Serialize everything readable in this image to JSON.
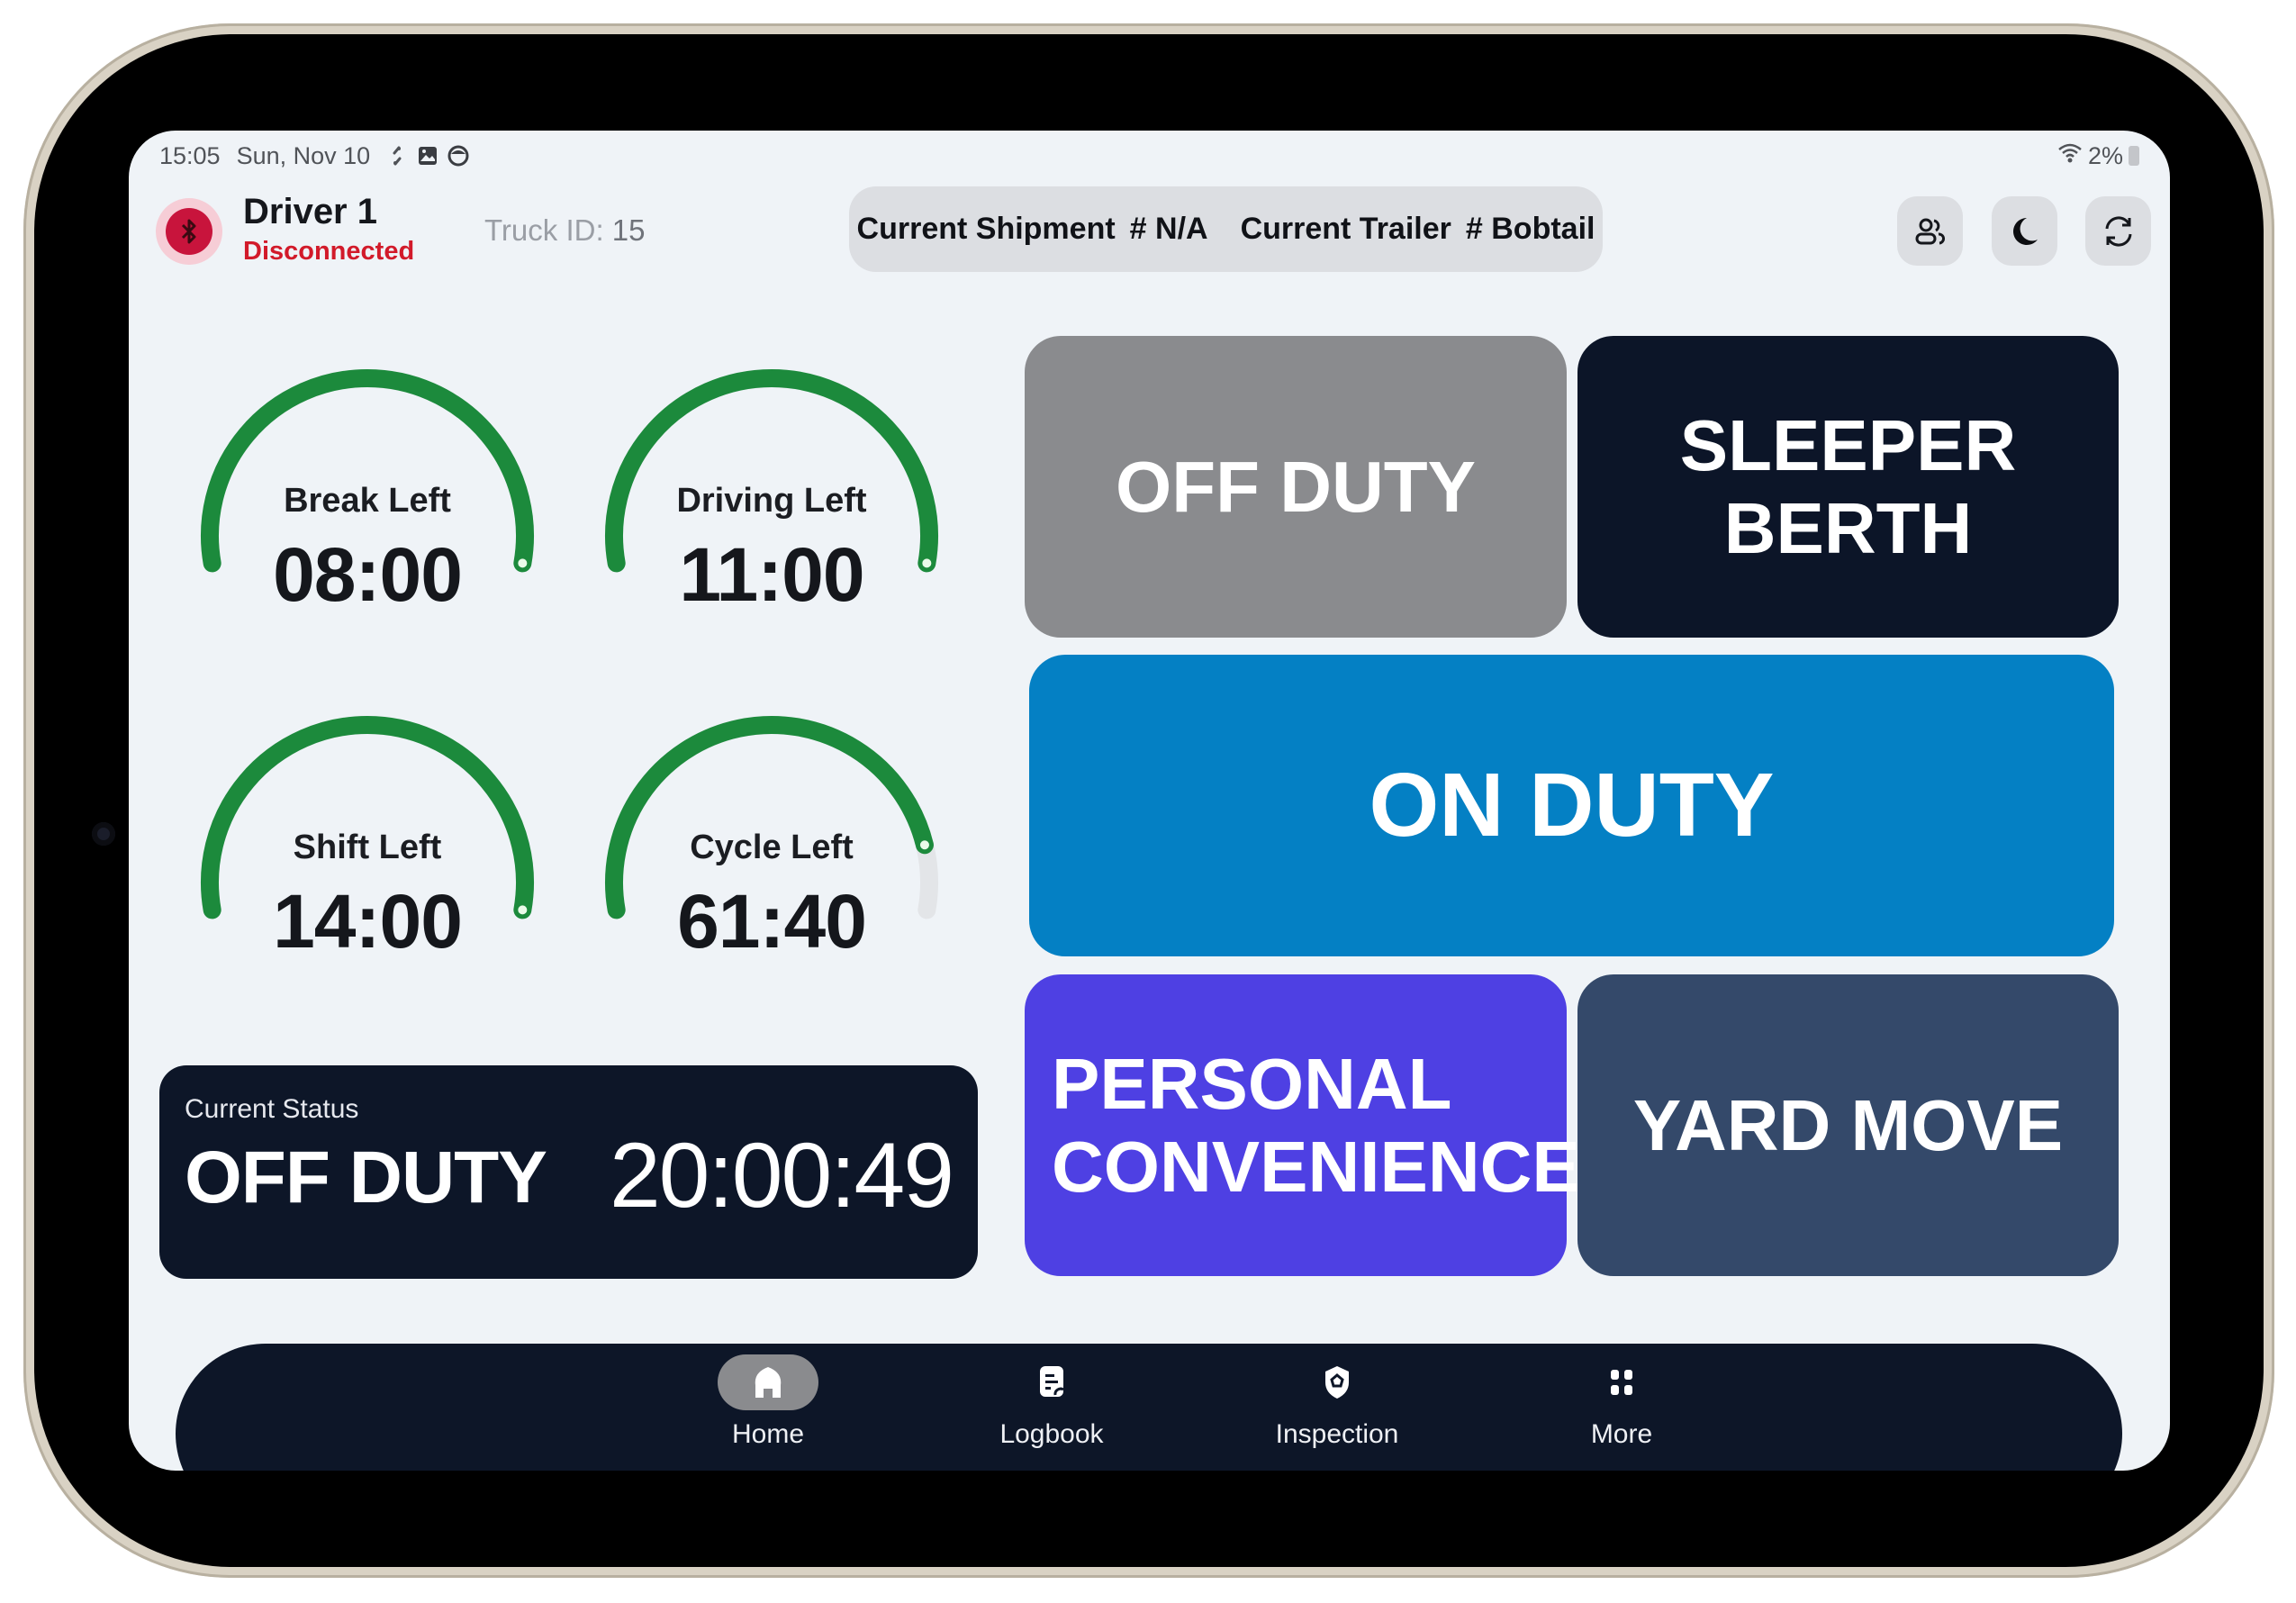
{
  "status_bar": {
    "time": "15:05",
    "date": "Sun, Nov 10",
    "notification_icons": [
      "sync-icon",
      "gallery-icon",
      "app-icon"
    ],
    "battery": "2%",
    "wifi_icon": "wifi-icon"
  },
  "header": {
    "driver_name": "Driver 1",
    "connection_status": "Disconnected",
    "connection_icon": "bluetooth-icon",
    "truck_id_label": "Truck ID:",
    "truck_id_value": "15",
    "shipment_label": "Current Shipment",
    "shipment_value": "# N/A",
    "trailer_label": "Current Trailer",
    "trailer_value": "# Bobtail",
    "actions": [
      {
        "name": "co-driver",
        "icon": "users-icon"
      },
      {
        "name": "dark-mode",
        "icon": "moon-icon"
      },
      {
        "name": "sync",
        "icon": "refresh-icon"
      }
    ]
  },
  "gauges": [
    {
      "label": "Break Left",
      "value": "08:00",
      "remaining_fraction": 1.0
    },
    {
      "label": "Driving Left",
      "value": "11:00",
      "remaining_fraction": 1.0
    },
    {
      "label": "Shift Left",
      "value": "14:00",
      "remaining_fraction": 1.0
    },
    {
      "label": "Cycle Left",
      "value": "61:40",
      "remaining_fraction": 0.881
    }
  ],
  "colors": {
    "gauge_fill": "#1c8a3c",
    "gauge_track": "#e3e5e8",
    "off_duty": "#8a8b8e",
    "sleeper_berth": "#0c1528",
    "on_duty": "#0480c4",
    "personal_conveyance": "#4e40e3",
    "yard_move": "#34496a",
    "status_card": "#0d1628",
    "disconnected": "#d21a2a"
  },
  "current_status": {
    "caption": "Current Status",
    "status": "OFF DUTY",
    "timer": "20:00:49"
  },
  "duty_buttons": {
    "off_duty": "OFF DUTY",
    "sleeper_line1": "SLEEPER",
    "sleeper_line2": "BERTH",
    "on_duty": "ON DUTY",
    "personal_line1": "PERSONAL",
    "personal_line2": "CONVENIENCE",
    "yard_move": "YARD MOVE"
  },
  "bottom_nav": {
    "items": [
      {
        "label": "Home",
        "icon": "home-icon",
        "active": true
      },
      {
        "label": "Logbook",
        "icon": "logbook-icon",
        "active": false
      },
      {
        "label": "Inspection",
        "icon": "inspection-shield-icon",
        "active": false
      },
      {
        "label": "More",
        "icon": "grid-icon",
        "active": false
      }
    ]
  }
}
